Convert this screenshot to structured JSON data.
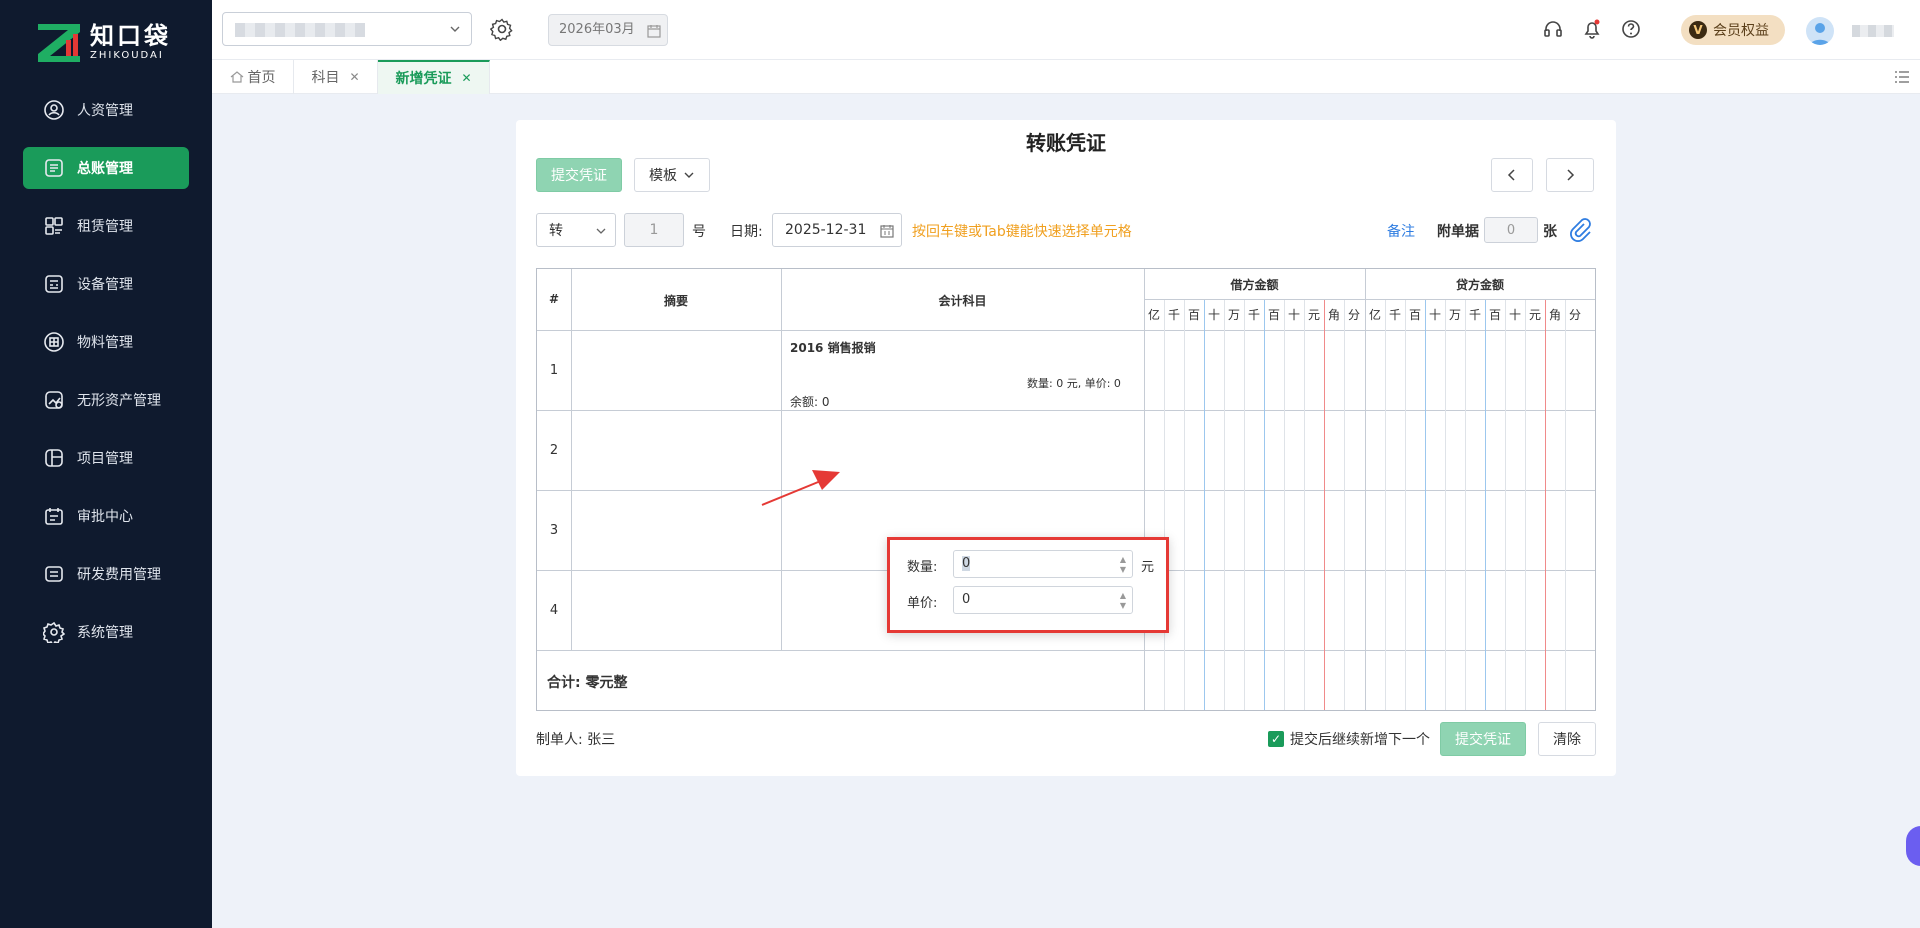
{
  "brand": {
    "name_cn": "知口袋",
    "name_en": "ZHIKOUDAI"
  },
  "sidebar": {
    "items": [
      {
        "label": "人资管理",
        "icon": "user-badge-icon",
        "active": false
      },
      {
        "label": "总账管理",
        "icon": "ledger-icon",
        "active": true
      },
      {
        "label": "租赁管理",
        "icon": "lease-icon",
        "active": false
      },
      {
        "label": "设备管理",
        "icon": "device-icon",
        "active": false
      },
      {
        "label": "物料管理",
        "icon": "material-icon",
        "active": false
      },
      {
        "label": "无形资产管理",
        "icon": "intangible-asset-icon",
        "active": false
      },
      {
        "label": "项目管理",
        "icon": "project-icon",
        "active": false
      },
      {
        "label": "审批中心",
        "icon": "approval-icon",
        "active": false
      },
      {
        "label": "研发费用管理",
        "icon": "rd-expense-icon",
        "active": false
      },
      {
        "label": "系统管理",
        "icon": "settings-icon",
        "active": false
      }
    ]
  },
  "header": {
    "period": "2026年03月",
    "member_label": "会员权益",
    "member_badge": "V"
  },
  "tabs": [
    {
      "label": "首页",
      "closable": false,
      "active": false
    },
    {
      "label": "科目",
      "closable": true,
      "active": false
    },
    {
      "label": "新增凭证",
      "closable": true,
      "active": true
    }
  ],
  "voucher": {
    "title": "转账凭证",
    "submit_label": "提交凭证",
    "template_label": "模板",
    "type_value": "转",
    "number_value": "1",
    "number_suffix": "号",
    "date_label": "日期:",
    "date_value": "2025-12-31",
    "hint": "按回车键或Tab键能快速选择单元格",
    "remark_label": "备注",
    "attachment_label": "附单据",
    "attachment_value": "0",
    "attachment_unit": "张",
    "columns": {
      "index": "#",
      "summary": "摘要",
      "account": "会计科目",
      "debit": "借方金额",
      "credit": "贷方金额",
      "digits": [
        "亿",
        "千",
        "百",
        "十",
        "万",
        "千",
        "百",
        "十",
        "元",
        "角",
        "分"
      ]
    },
    "rows": [
      {
        "no": "1",
        "account": "2016 销售报销",
        "qty_price": "数量: 0 元, 单价: 0",
        "balance": "余额: 0"
      },
      {
        "no": "2"
      },
      {
        "no": "3"
      },
      {
        "no": "4"
      }
    ],
    "total": "合计: 零元整",
    "maker_label": "制单人: 张三",
    "continue_label": "提交后继续新增下一个",
    "clear_label": "清除"
  },
  "popup": {
    "qty_label": "数量:",
    "qty_value": "0",
    "qty_unit": "元",
    "price_label": "单价:",
    "price_value": "0"
  },
  "colors": {
    "accent": "#1a9b5a",
    "sidebar_bg": "#0f1a2e",
    "highlight_red": "#e53935",
    "hint_orange": "#f0a020"
  }
}
